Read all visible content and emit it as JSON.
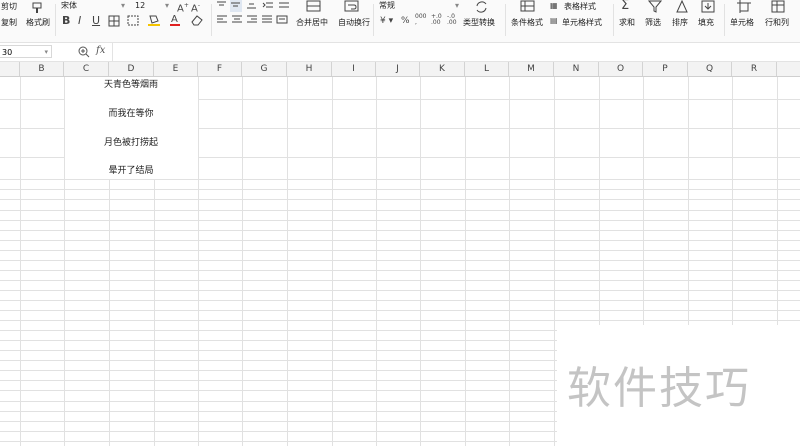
{
  "toolbar": {
    "cut": "剪切",
    "copy": "复制",
    "format_painter": "格式刷",
    "font_name": "宋体",
    "font_size": "12",
    "merge_center": "合并居中",
    "wrap_text": "自动换行",
    "number_format": "常规",
    "type_convert": "类型转换",
    "conditional_format": "条件格式",
    "table_style": "表格样式",
    "cell_style": "单元格样式",
    "sum": "求和",
    "filter": "筛选",
    "sort": "排序",
    "fill": "填充",
    "cell": "单元格",
    "row_col": "行和列"
  },
  "formula_bar": {
    "name_box": "30",
    "fx": "fx"
  },
  "columns": [
    "B",
    "C",
    "D",
    "E",
    "F",
    "G",
    "H",
    "I",
    "J",
    "K",
    "L",
    "M",
    "N",
    "O",
    "P",
    "Q",
    "R"
  ],
  "cells": {
    "d1": "天青色等烟雨",
    "d2": "而我在等你",
    "d3": "月色被打捞起",
    "d4": "晕开了结局"
  },
  "watermark": "软件技巧"
}
